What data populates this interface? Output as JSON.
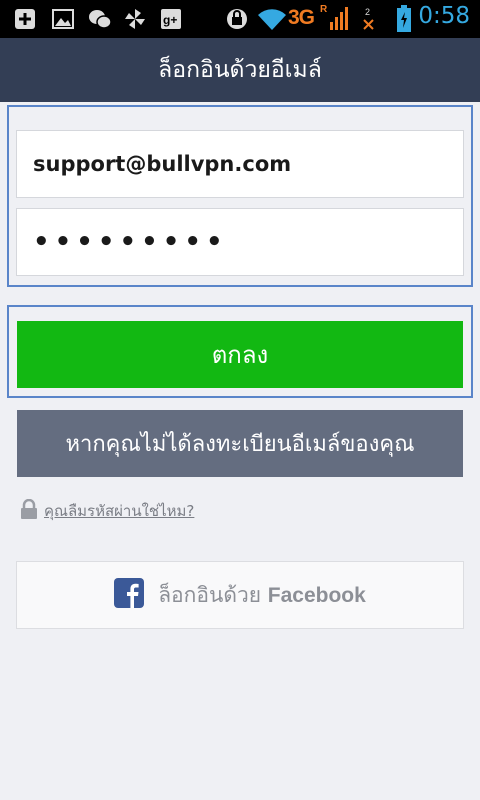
{
  "status_bar": {
    "network": "3G",
    "roaming": "R",
    "time": "0:58"
  },
  "header": {
    "title": "ล็อกอินด้วยอีเมล์"
  },
  "form": {
    "email_value": "support@bullvpn.com",
    "password_value": "•••••••••",
    "ok_label": "ตกลง",
    "register_label": "หากคุณไม่ได้ลงทะเบียนอีเมล์ของคุณ",
    "forgot_label": "คุณลืมรหัสผ่านใช่ไหม?",
    "facebook_prefix": "ล็อกอินด้วย",
    "facebook_brand": "Facebook"
  },
  "colors": {
    "header_bg": "#333e55",
    "ok_bg": "#12b812",
    "register_bg": "#646d80",
    "focus_frame": "#5a85c9",
    "facebook_blue": "#3b5998"
  },
  "icons": [
    "plus-icon",
    "image-icon",
    "wechat-icon",
    "pinwheel-icon",
    "google-plus-icon",
    "vpn-icon",
    "wifi-icon",
    "signal-icon",
    "no-sim-icon",
    "battery-icon",
    "lock-icon",
    "facebook-icon"
  ]
}
